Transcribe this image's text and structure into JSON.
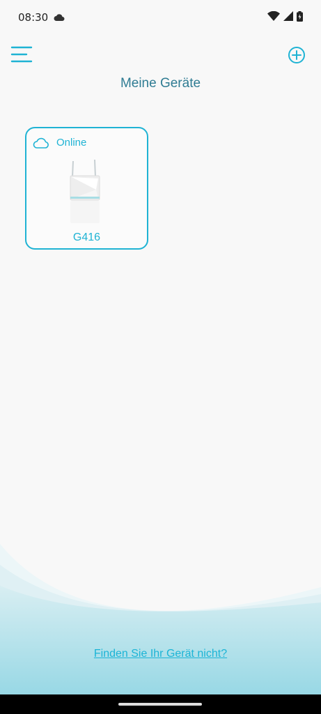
{
  "status_bar": {
    "time": "08:30",
    "icons": [
      "cloud-icon",
      "wifi-icon",
      "signal-icon",
      "battery-icon"
    ]
  },
  "header": {
    "menu_icon": "hamburger-menu-icon",
    "add_icon": "plus-circle-icon",
    "title": "Meine Geräte"
  },
  "devices": [
    {
      "status": "Online",
      "status_icon": "cloud-outline-icon",
      "name": "G416"
    }
  ],
  "footer": {
    "help_link": "Finden Sie Ihr Gerät nicht?"
  },
  "colors": {
    "accent": "#1fb3d4",
    "title": "#2f7c93",
    "background": "#f8f8f8",
    "wave": "#a6dde8"
  }
}
